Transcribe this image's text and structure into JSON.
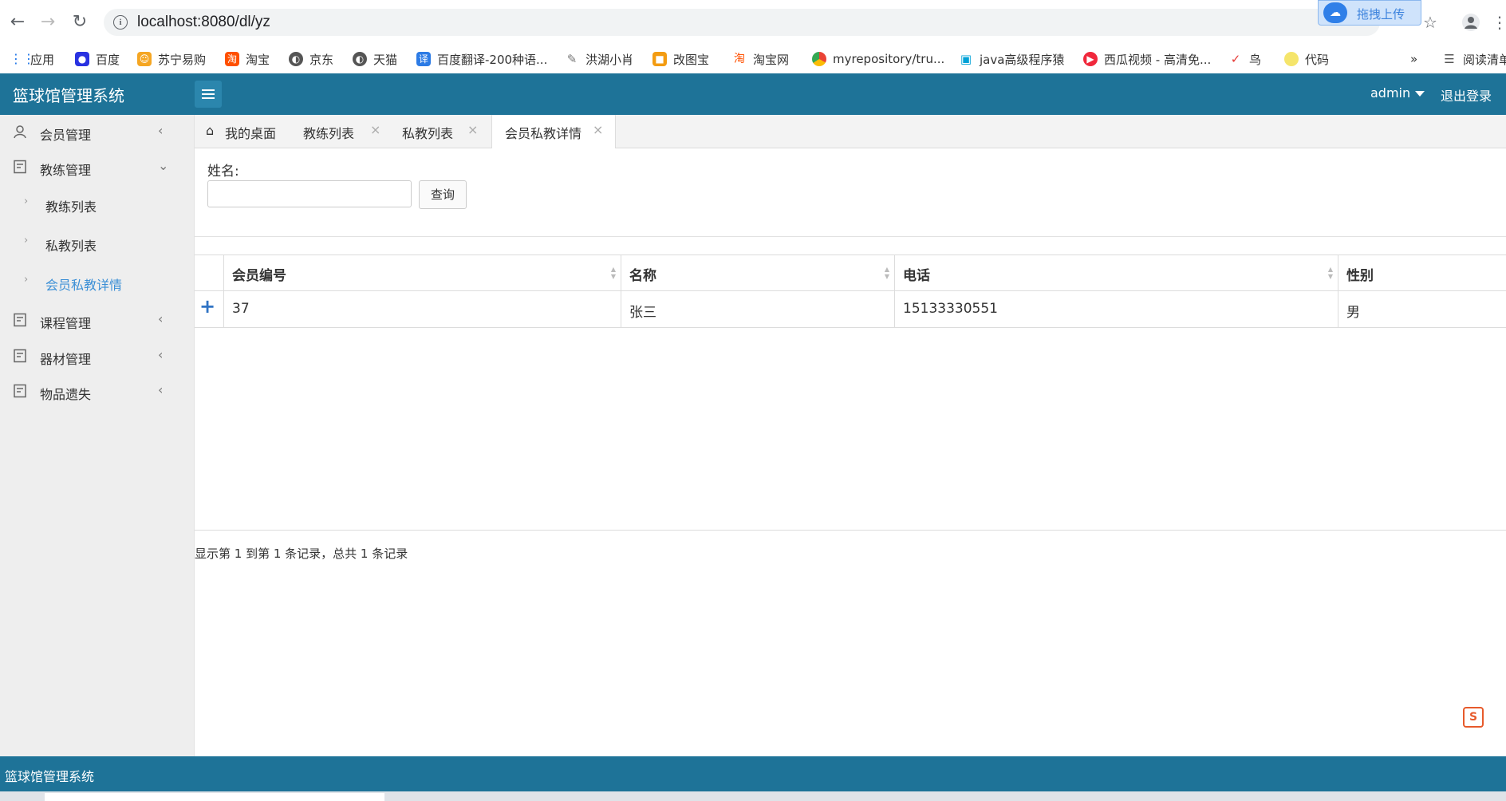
{
  "browser": {
    "url": "localhost:8080/dl/yz",
    "upload_badge": "拖拽上传",
    "bookmarks": [
      {
        "label": "应用",
        "icon": "apps-grid-icon",
        "color": "#1a73e8"
      },
      {
        "label": "百度",
        "icon": "baidu-paw-icon",
        "color": "#2932e1"
      },
      {
        "label": "苏宁易购",
        "icon": "suning-icon",
        "color": "#f5a623"
      },
      {
        "label": "淘宝",
        "icon": "taobao-icon",
        "color": "#ff5000"
      },
      {
        "label": "京东",
        "icon": "globe-icon",
        "color": "#555555"
      },
      {
        "label": "天猫",
        "icon": "globe-icon",
        "color": "#555555"
      },
      {
        "label": "百度翻译-200种语...",
        "icon": "translate-icon",
        "color": "#2c7be5"
      },
      {
        "label": "洪湖小肖",
        "icon": "pen-icon",
        "color": "#777777"
      },
      {
        "label": "改图宝",
        "icon": "gaitubao-icon",
        "color": "#f39c12"
      },
      {
        "label": "淘宝网",
        "icon": "taobao-icon",
        "color": "#ff5000"
      },
      {
        "label": "myrepository/tru...",
        "icon": "chrome-icon",
        "color": "#4caf50"
      },
      {
        "label": "java高级程序猿",
        "icon": "bilibili-icon",
        "color": "#00a1d6"
      },
      {
        "label": "西瓜视频 - 高清免...",
        "icon": "xigua-icon",
        "color": "#f0283c"
      },
      {
        "label": "鸟",
        "icon": "bird-icon",
        "color": "#e53935"
      },
      {
        "label": "代码",
        "icon": "leaf-icon",
        "color": "#f5e56b"
      }
    ],
    "overflow": "»",
    "reading_list": "阅读清单"
  },
  "header": {
    "brand": "篮球馆管理系统",
    "user": "admin",
    "logout": "退出登录"
  },
  "sidebar": {
    "items": [
      {
        "label": "会员管理",
        "icon": "user-icon",
        "arrow": "‹"
      },
      {
        "label": "教练管理",
        "icon": "doc-icon",
        "arrow": "⌄"
      },
      {
        "label": "课程管理",
        "icon": "doc-icon",
        "arrow": "‹"
      },
      {
        "label": "器材管理",
        "icon": "doc-icon",
        "arrow": "‹"
      },
      {
        "label": "物品遗失",
        "icon": "doc-icon",
        "arrow": "‹"
      }
    ],
    "sub_items": [
      {
        "label": "教练列表"
      },
      {
        "label": "私教列表"
      },
      {
        "label": "会员私教详情",
        "active": true
      }
    ]
  },
  "tabs": [
    {
      "label": "我的桌面",
      "closable": false
    },
    {
      "label": "教练列表",
      "closable": true
    },
    {
      "label": "私教列表",
      "closable": true
    },
    {
      "label": "会员私教详情",
      "closable": true,
      "active": true
    }
  ],
  "search": {
    "label": "姓名:",
    "value": "",
    "button": "查询"
  },
  "table": {
    "columns": [
      "会员编号",
      "名称",
      "电话",
      "性别"
    ],
    "rows": [
      [
        "37",
        "张三",
        "15133330551",
        "男"
      ]
    ],
    "expand_symbol": "+"
  },
  "pagination": {
    "summary": "显示第 1 到第 1 条记录，总共 1 条记录"
  },
  "footer": {
    "text": "篮球馆管理系统"
  },
  "colors": {
    "primary": "#1e7398",
    "active_link": "#3b8fd6"
  }
}
